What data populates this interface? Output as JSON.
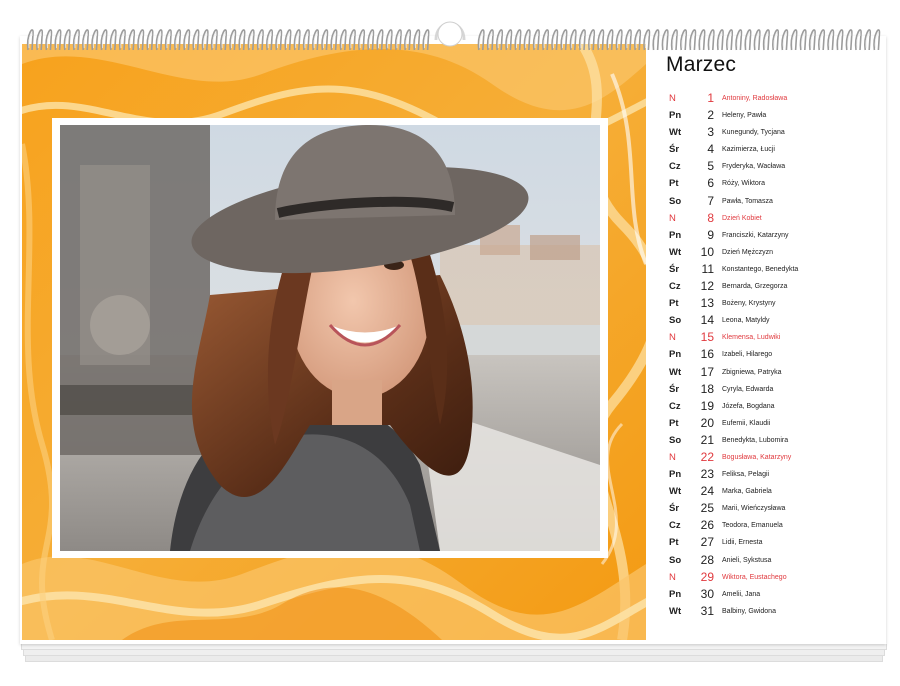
{
  "calendar": {
    "month": "Marzec",
    "colors": {
      "sunday": "#e0393e",
      "text": "#222222",
      "marble_base": "#f6a92b",
      "marble_light": "#fde3a8"
    },
    "days": [
      {
        "dow": "N",
        "day": "1",
        "names": "Antoniny, Radosława",
        "sunday": true
      },
      {
        "dow": "Pn",
        "day": "2",
        "names": "Heleny, Pawła"
      },
      {
        "dow": "Wt",
        "day": "3",
        "names": "Kunegundy, Tycjana"
      },
      {
        "dow": "Śr",
        "day": "4",
        "names": "Kazimierza, Łucji"
      },
      {
        "dow": "Cz",
        "day": "5",
        "names": "Fryderyka, Wacława"
      },
      {
        "dow": "Pt",
        "day": "6",
        "names": "Róży, Wiktora"
      },
      {
        "dow": "So",
        "day": "7",
        "names": "Pawła, Tomasza"
      },
      {
        "dow": "N",
        "day": "8",
        "names": "Dzień Kobiet",
        "sunday": true
      },
      {
        "dow": "Pn",
        "day": "9",
        "names": "Franciszki, Katarzyny"
      },
      {
        "dow": "Wt",
        "day": "10",
        "names": "Dzień Mężczyzn"
      },
      {
        "dow": "Śr",
        "day": "11",
        "names": "Konstantego, Benedykta"
      },
      {
        "dow": "Cz",
        "day": "12",
        "names": "Bernarda, Grzegorza"
      },
      {
        "dow": "Pt",
        "day": "13",
        "names": "Bożeny, Krystyny"
      },
      {
        "dow": "So",
        "day": "14",
        "names": "Leona, Matyldy"
      },
      {
        "dow": "N",
        "day": "15",
        "names": "Klemensa, Ludwiki",
        "sunday": true
      },
      {
        "dow": "Pn",
        "day": "16",
        "names": "Izabeli, Hilarego"
      },
      {
        "dow": "Wt",
        "day": "17",
        "names": "Zbigniewa, Patryka"
      },
      {
        "dow": "Śr",
        "day": "18",
        "names": "Cyryla, Edwarda"
      },
      {
        "dow": "Cz",
        "day": "19",
        "names": "Józefa, Bogdana"
      },
      {
        "dow": "Pt",
        "day": "20",
        "names": "Eufemii, Klaudii"
      },
      {
        "dow": "So",
        "day": "21",
        "names": "Benedykta, Lubomira"
      },
      {
        "dow": "N",
        "day": "22",
        "names": "Bogusława, Katarzyny",
        "sunday": true
      },
      {
        "dow": "Pn",
        "day": "23",
        "names": "Feliksa, Pelagii"
      },
      {
        "dow": "Wt",
        "day": "24",
        "names": "Marka, Gabriela"
      },
      {
        "dow": "Śr",
        "day": "25",
        "names": "Marii, Wieńczysława"
      },
      {
        "dow": "Cz",
        "day": "26",
        "names": "Teodora, Emanuela"
      },
      {
        "dow": "Pt",
        "day": "27",
        "names": "Lidii, Ernesta"
      },
      {
        "dow": "So",
        "day": "28",
        "names": "Anieli, Sykstusa"
      },
      {
        "dow": "N",
        "day": "29",
        "names": "Wiktora, Eustachego",
        "sunday": true
      },
      {
        "dow": "Pn",
        "day": "30",
        "names": "Amelii, Jana"
      },
      {
        "dow": "Wt",
        "day": "31",
        "names": "Balbiny, Gwidona"
      }
    ]
  }
}
